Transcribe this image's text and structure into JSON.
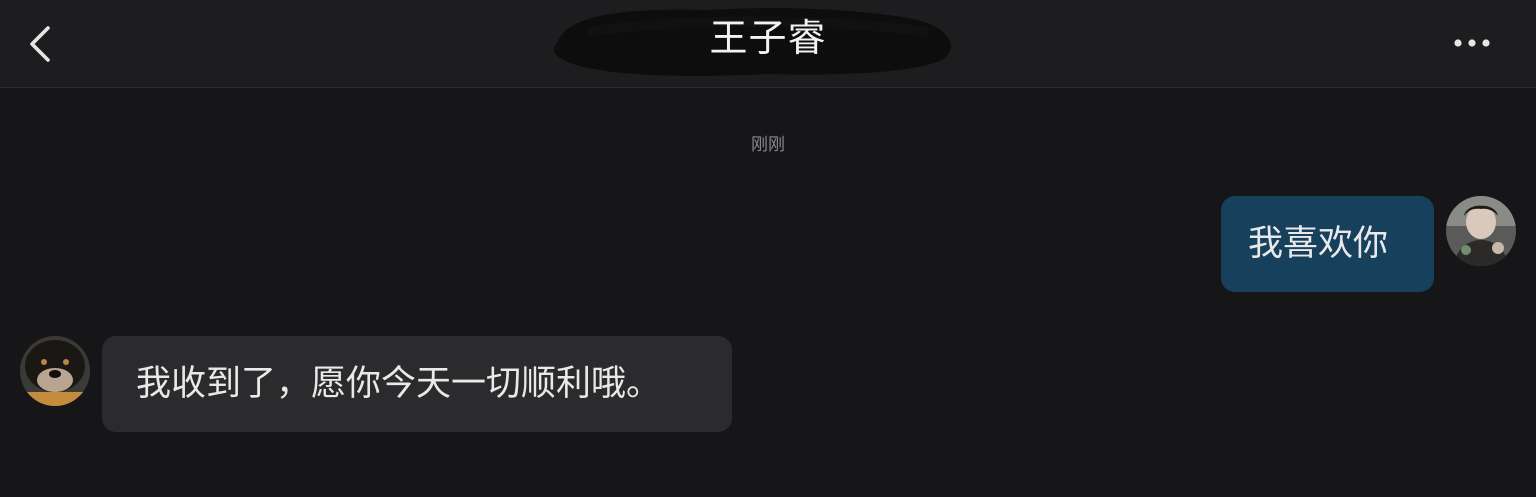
{
  "header": {
    "title": "王子睿",
    "back_icon": "chevron-left-icon",
    "more_icon": "more-horizontal-icon"
  },
  "timestamp": "刚刚",
  "messages": [
    {
      "sender": "self",
      "text": "我喜欢你",
      "bubble_color": "#17405c"
    },
    {
      "sender": "other",
      "text": "我收到了，愿你今天一切顺利哦。",
      "bubble_color": "#2b2b2d"
    }
  ],
  "colors": {
    "background": "#161618",
    "header": "#1d1d1f",
    "text": "#e9e9ea",
    "timestamp": "#8a8a8e"
  }
}
